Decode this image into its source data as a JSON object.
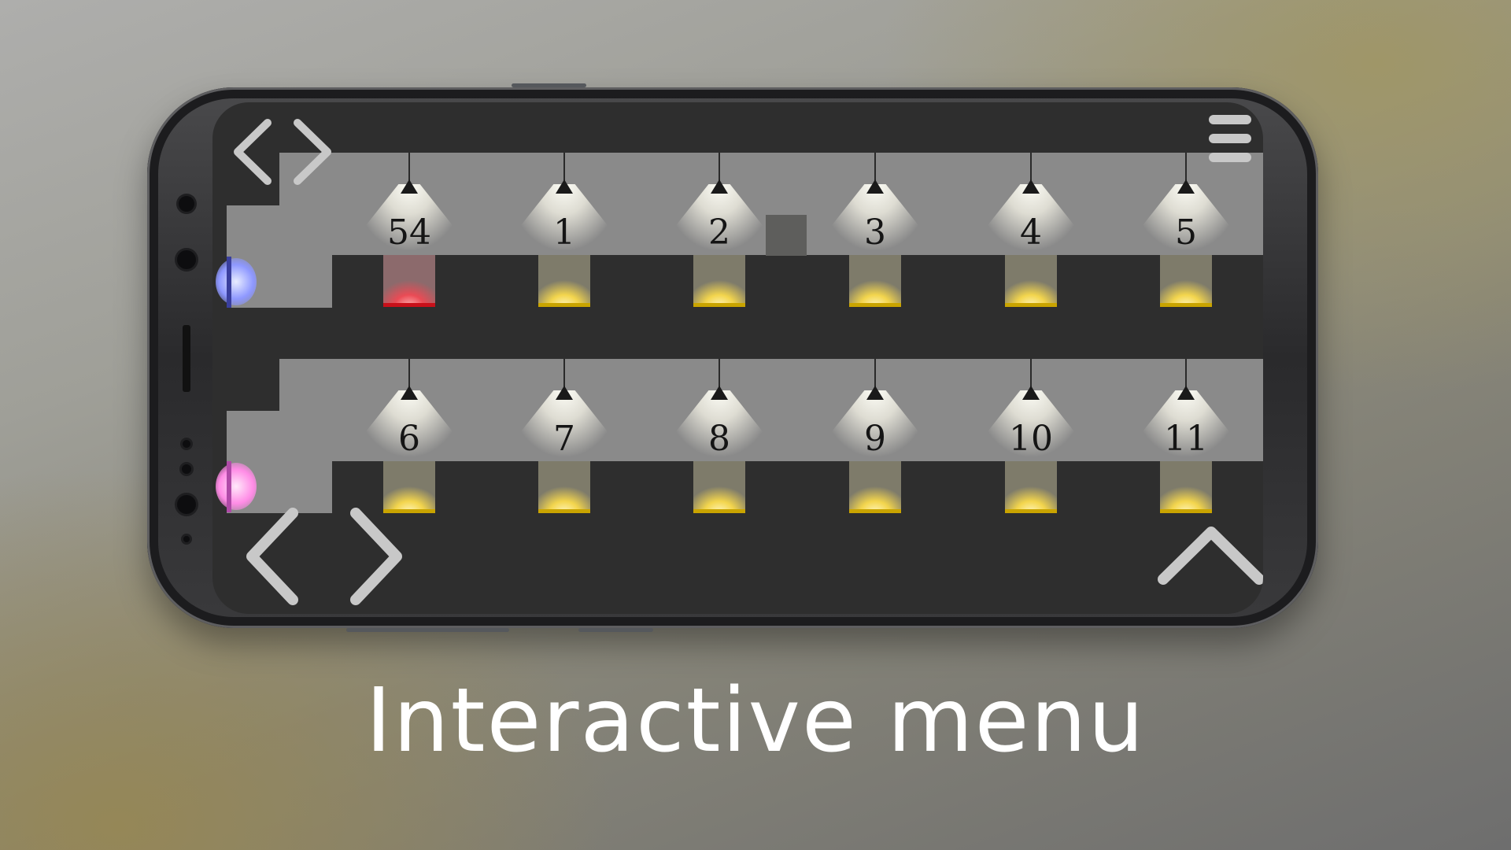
{
  "caption": "Interactive menu",
  "colors": {
    "screen_bg": "#2e2e2e",
    "room": "#8a8a8a",
    "light_pit": "#f3d54d",
    "active_pit": "#ea4b55",
    "player_blue": "#8e98ff",
    "player_pink": "#ff8ce6",
    "controls": "#c8c8c8"
  },
  "controls": {
    "top_prev": "chevron-left-icon",
    "top_next": "chevron-right-icon",
    "menu": "menu-icon",
    "bottom_prev": "chevron-left-icon",
    "bottom_next": "chevron-right-icon",
    "jump": "chevron-up-icon"
  },
  "levels_row1": [
    "54",
    "1",
    "2",
    "3",
    "4",
    "5"
  ],
  "levels_row2": [
    "6",
    "7",
    "8",
    "9",
    "10",
    "11"
  ],
  "active_level": "54"
}
